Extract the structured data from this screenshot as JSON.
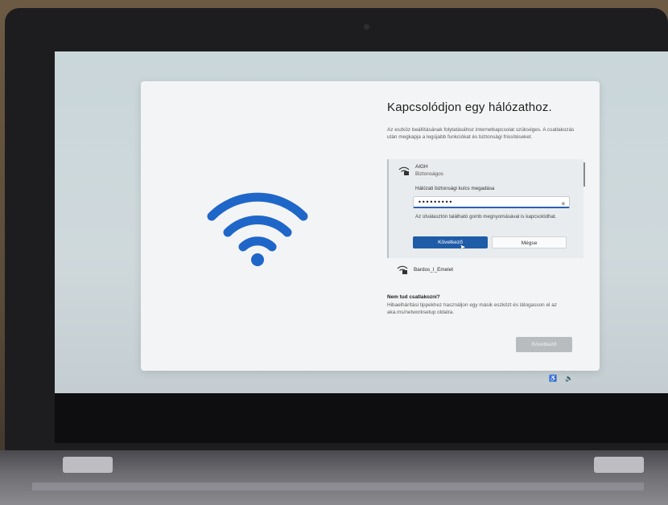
{
  "dialog": {
    "title": "Kapcsolódjon egy hálózathoz.",
    "description": "Az eszköz beállításának folytatásához internetkapcsolat szükséges. A csatlakozás után megkapja a legújabb funkciókat és biztonsági frissítéseket.",
    "networks": [
      {
        "name": "AIGH",
        "status": "Biztonságos",
        "selected": true,
        "key_label": "Hálózati biztonsági kulcs megadása",
        "password_value": "•••••••••",
        "hint": "Az útválasztón található gomb megnyomásával is kapcsolódhat.",
        "connect_label": "Következő",
        "cancel_label": "Mégse"
      },
      {
        "name": "Bardos_I_Emelet",
        "selected": false
      }
    ],
    "help_title": "Nem tud csatlakozni?",
    "help_text": "Hibaelhárítási tippekhez használjon egy másik eszközt és látogasson el az aka.ms/networksetup oldalra.",
    "next_label": "Következő"
  },
  "icons": {
    "wifi_illustration": "wifi-icon",
    "network_icon": "wifi-lock-icon",
    "password_reveal": "eye-icon",
    "tray": [
      "accessibility-icon",
      "volume-icon"
    ]
  },
  "colors": {
    "accent": "#1f5ca8",
    "wifi_illustration": "#1f66c9",
    "disabled_button": "#b9bcbf"
  }
}
